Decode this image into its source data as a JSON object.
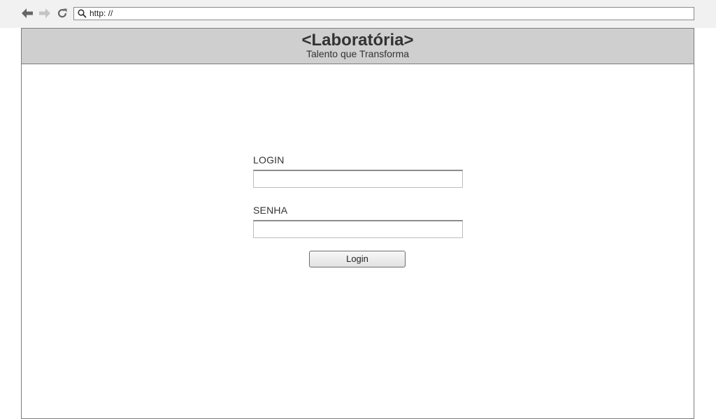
{
  "browser": {
    "url": "http: //",
    "icons": {
      "back": "back-arrow-icon",
      "forward": "forward-arrow-icon",
      "reload": "reload-icon",
      "search": "search-icon"
    }
  },
  "header": {
    "title": "<Laboratória>",
    "subtitle": "Talento que Transforma",
    "background": "#cfcfcf"
  },
  "form": {
    "login_label": "LOGIN",
    "login_value": "",
    "password_label": "SENHA",
    "password_value": "",
    "submit_label": "Login"
  }
}
